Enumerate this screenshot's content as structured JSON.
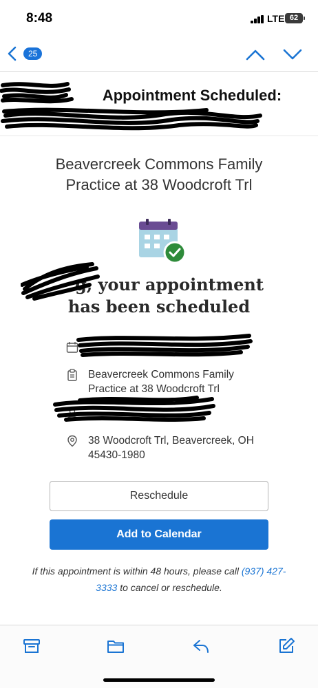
{
  "status_bar": {
    "time": "8:48",
    "network": "LTE",
    "battery": "62"
  },
  "nav": {
    "unread_count": "25"
  },
  "email": {
    "subject_visible": "Appointment Scheduled:",
    "practice_name_line1": "Beavercreek Commons Family",
    "practice_name_line2": "Practice at 38 Woodcroft Trl",
    "headline_line1": "g, your appointment",
    "headline_line2": "has been scheduled",
    "location_line1": "Beavercreek Commons Family",
    "location_line2": "Practice at 38 Woodcroft Trl",
    "address_line1": "38 Woodcroft Trl, Beavercreek, OH",
    "address_line2": "45430-1980",
    "reschedule_label": "Reschedule",
    "add_calendar_label": "Add to Calendar",
    "note_before": "If this appointment is within 48 hours, please call ",
    "note_phone": "(937) 427-3333",
    "note_after": " to cancel or reschedule."
  },
  "colors": {
    "accent": "#1a74d3",
    "calendar_header": "#6a4c93",
    "calendar_body": "#a9d4e4",
    "check_badge": "#2e8b3a"
  }
}
